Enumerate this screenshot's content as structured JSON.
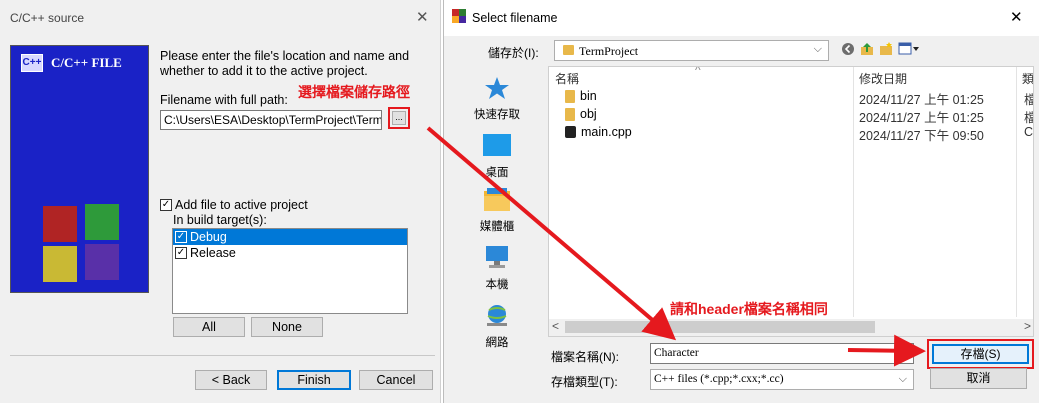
{
  "wizard": {
    "title": "C/C++ source",
    "banner_title": "C/C++ FILE",
    "logo_text": "C++",
    "instruction": "Please enter the file's location and name and whether to add it to the active project.",
    "path_label": "Filename with full path:",
    "path_value": "C:\\Users\\ESA\\Desktop\\TermProject\\Term",
    "browse_label": "...",
    "annotation_path": "選擇檔案儲存路徑",
    "add_to_project_label": "Add file to active project",
    "build_target_label": "In build target(s):",
    "targets": [
      {
        "label": "Debug",
        "checked": true,
        "selected": true
      },
      {
        "label": "Release",
        "checked": true,
        "selected": false
      }
    ],
    "all_label": "All",
    "none_label": "None",
    "back_label": "< Back",
    "finish_label": "Finish",
    "cancel_label": "Cancel",
    "check_mark": "✓",
    "close_glyph": "✕"
  },
  "save_dialog": {
    "title": "Select filename",
    "save_in_label": "儲存於(I):",
    "location": "TermProject",
    "places": [
      {
        "label": "快速存取",
        "icon": "star-icon"
      },
      {
        "label": "桌面",
        "icon": "desktop-icon"
      },
      {
        "label": "媒體櫃",
        "icon": "library-icon"
      },
      {
        "label": "本機",
        "icon": "computer-icon"
      },
      {
        "label": "網路",
        "icon": "network-icon"
      }
    ],
    "columns": {
      "name": "名稱",
      "date": "修改日期",
      "type": "類"
    },
    "files": [
      {
        "name": "bin",
        "date": "2024/11/27 上午 01:25",
        "type": "檔",
        "icon": "folder-icon"
      },
      {
        "name": "obj",
        "date": "2024/11/27 上午 01:25",
        "type": "檔",
        "icon": "folder-icon"
      },
      {
        "name": "main.cpp",
        "date": "2024/11/27 下午 09:50",
        "type": "C",
        "icon": "cpp-file-icon"
      }
    ],
    "annotation_name": "請和header檔案名稱相同",
    "filename_label": "檔案名稱(N):",
    "filename_value": "Character",
    "filetype_label": "存檔類型(T):",
    "filetype_value": "C++ files (*.cpp;*.cxx;*.cc)",
    "save_label": "存檔(S)",
    "cancel_label": "取消",
    "close_glyph": "✕",
    "sort_glyph": "^",
    "scroll_left_glyph": "<",
    "scroll_right_glyph": ">",
    "dropdown_glyph": "⌵"
  },
  "colors": {
    "annotation_red": "#e5191e",
    "banner_blue": "#1a22c6",
    "selection_blue": "#0078d7"
  }
}
